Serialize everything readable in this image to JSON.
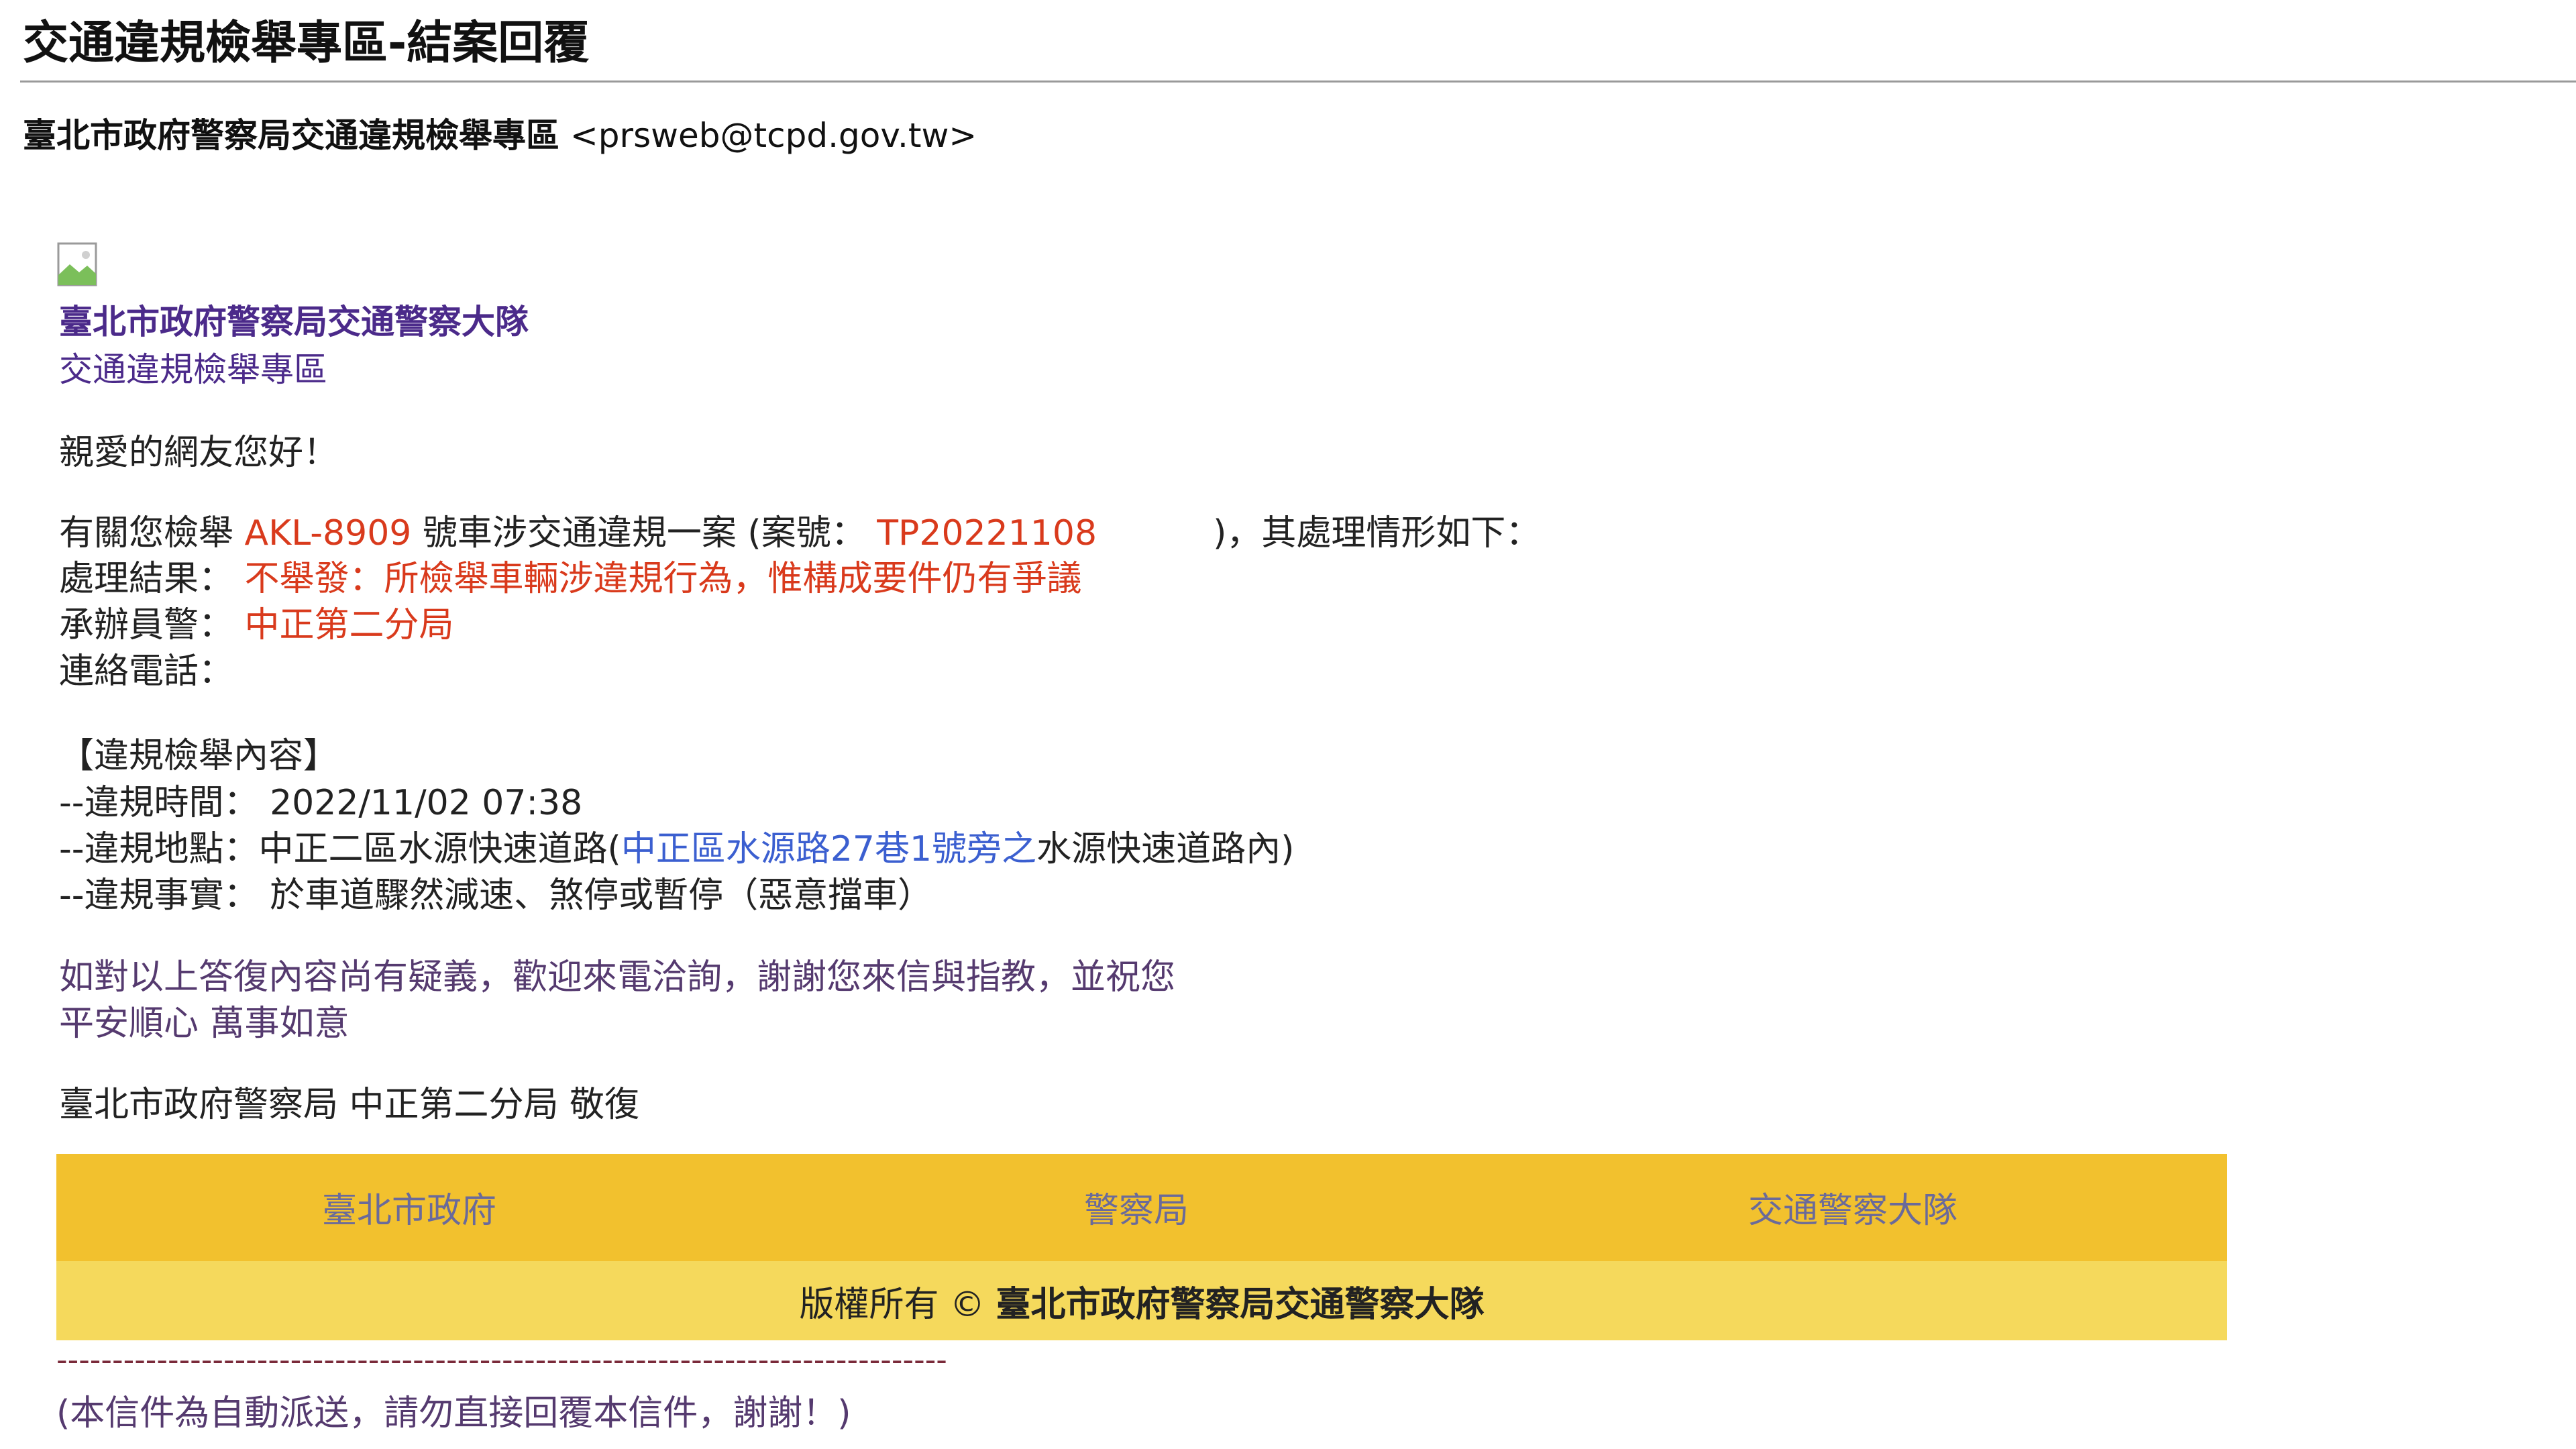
{
  "email": {
    "subject": "交通違規檢舉專區-結案回覆",
    "sender_name": "臺北市政府警察局交通違規檢舉專區",
    "sender_email": "<prsweb@tcpd.gov.tw>"
  },
  "header": {
    "org_title": "臺北市政府警察局交通警察大隊",
    "org_subtitle": "交通違規檢舉專區"
  },
  "message": {
    "greeting": "親愛的網友您好！",
    "intro_prefix": "有關您檢舉",
    "plate": "AKL-8909",
    "intro_middle": "號車涉交通違規一案 (案號：",
    "case_no": "TP20221108",
    "intro_suffix": ")，其處理情形如下：",
    "result_label": "處理結果：",
    "result_value": "不舉發：所檢舉車輛涉違規行為，惟構成要件仍有爭議",
    "officer_label": "承辦員警：",
    "officer_value": "中正第二分局",
    "phone_label": "連絡電話：",
    "phone_value": "",
    "content_heading": "【違規檢舉內容】",
    "time_label": "--違規時間：",
    "time_value": "2022/11/02 07:38",
    "location_label": "--違規地點：中正二區水源快速道路(",
    "location_link": "中正區水源路27巷1號旁之",
    "location_suffix": "水源快速道路內)",
    "fact_label": "--違規事實：",
    "fact_value": "於車道驟然減速、煞停或暫停（惡意擋車）",
    "closing_line1": "如對以上答復內容尚有疑義，歡迎來電洽詢，謝謝您來信與指教，並祝您",
    "closing_line2": "平安順心 萬事如意",
    "signature": "臺北市政府警察局 中正第二分局 敬復"
  },
  "footer": {
    "links": [
      "臺北市政府",
      "警察局",
      "交通警察大隊"
    ],
    "copyright_prefix": "版權所有 © ",
    "copyright_owner": "臺北市政府警察局交通警察大隊",
    "divider": "--------------------------------------------------------------------------------",
    "auto_note": "(本信件為自動派送，請勿直接回覆本信件，謝謝！)"
  },
  "colors": {
    "highlight": "#d93a1c",
    "link": "#3b5fd0",
    "org_text": "#4b2a8a",
    "footer_top": "#f2c12e",
    "footer_bottom": "#f5d95c"
  }
}
